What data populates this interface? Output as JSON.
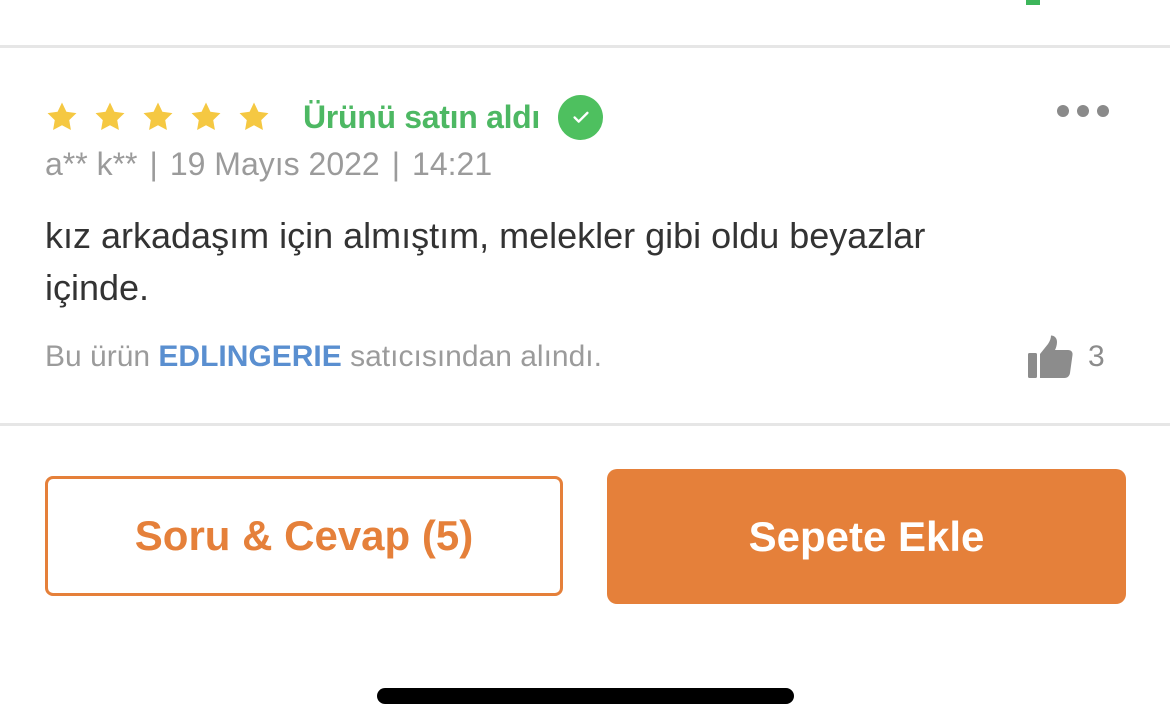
{
  "review": {
    "rating": 5,
    "max_rating": 5,
    "star_color": "#f5c842",
    "verified_label": "Ürünü satın aldı",
    "verified_color": "#4db863",
    "author": "a** k**",
    "date": "19 Mayıs 2022",
    "time": "14:21",
    "separator": "|",
    "comment": "kız arkadaşım için almıştım, melekler gibi oldu beyazlar içinde.",
    "seller_prefix": "Bu ürün",
    "seller_name": "EDLINGERIE",
    "seller_suffix": "satıcısından alındı.",
    "like_count": "3"
  },
  "actions": {
    "qa_label": "Soru & Cevap (5)",
    "cart_label": "Sepete Ekle",
    "accent_color": "#e5803a"
  },
  "icons": {
    "star": "star-icon",
    "verified": "check-circle-icon",
    "more": "more-dots-icon",
    "like": "thumbs-up-icon"
  }
}
